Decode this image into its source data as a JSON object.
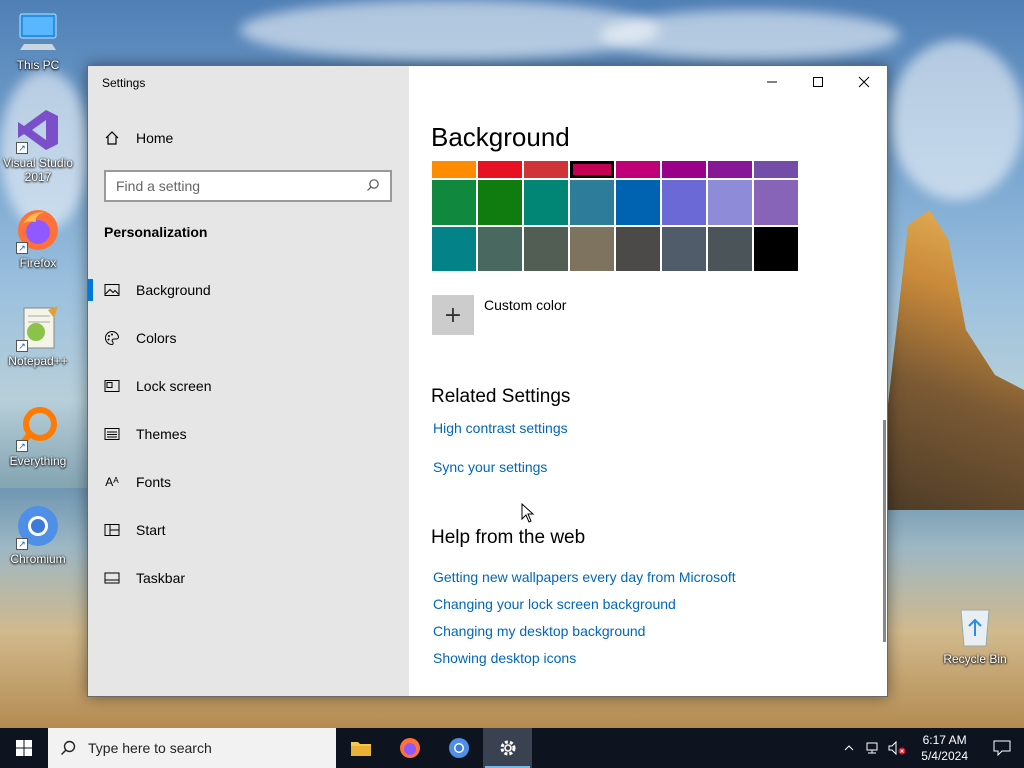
{
  "desktop": {
    "icons": [
      {
        "label": "This PC"
      },
      {
        "label": "Visual Studio 2017"
      },
      {
        "label": "Firefox"
      },
      {
        "label": "Notepad++"
      },
      {
        "label": "Everything"
      },
      {
        "label": "Chromium"
      },
      {
        "label": "Recycle Bin"
      }
    ]
  },
  "window": {
    "title": "Settings",
    "sidebar": {
      "home_label": "Home",
      "search_placeholder": "Find a setting",
      "section_title": "Personalization",
      "items": [
        {
          "label": "Background",
          "icon": "picture-icon",
          "active": true
        },
        {
          "label": "Colors",
          "icon": "palette-icon"
        },
        {
          "label": "Lock screen",
          "icon": "lock-screen-icon"
        },
        {
          "label": "Themes",
          "icon": "brush-icon"
        },
        {
          "label": "Fonts",
          "icon": "font-icon"
        },
        {
          "label": "Start",
          "icon": "start-icon"
        },
        {
          "label": "Taskbar",
          "icon": "taskbar-icon"
        }
      ]
    },
    "content": {
      "heading": "Background",
      "palette_rows": [
        [
          "#ff8c00",
          "#e81123",
          "#d13438",
          "#c30052",
          "#bf0077",
          "#9a0089",
          "#881798",
          "#744da9"
        ],
        [
          "#10893e",
          "#107c10",
          "#018574",
          "#2d7d9a",
          "#0063b1",
          "#6b69d6",
          "#8e8cd8",
          "#8764b8"
        ],
        [
          "#038387",
          "#486860",
          "#525e54",
          "#7e735f",
          "#4c4a48",
          "#515c6b",
          "#4a5459",
          "#000000"
        ]
      ],
      "selected_swatch": "#c30052",
      "custom_color_label": "Custom color",
      "related_heading": "Related Settings",
      "related_links": [
        "High contrast settings",
        "Sync your settings"
      ],
      "help_heading": "Help from the web",
      "help_links": [
        "Getting new wallpapers every day from Microsoft",
        "Changing your lock screen background",
        "Changing my desktop background",
        "Showing desktop icons"
      ]
    }
  },
  "taskbar": {
    "search_placeholder": "Type here to search",
    "apps": [
      "File Explorer",
      "Firefox",
      "Chromium",
      "Settings"
    ],
    "time": "6:17 AM",
    "date": "5/4/2024"
  },
  "colors": {
    "accent": "#0078d7",
    "link": "#0067b8",
    "taskbar": "#0d1420"
  }
}
